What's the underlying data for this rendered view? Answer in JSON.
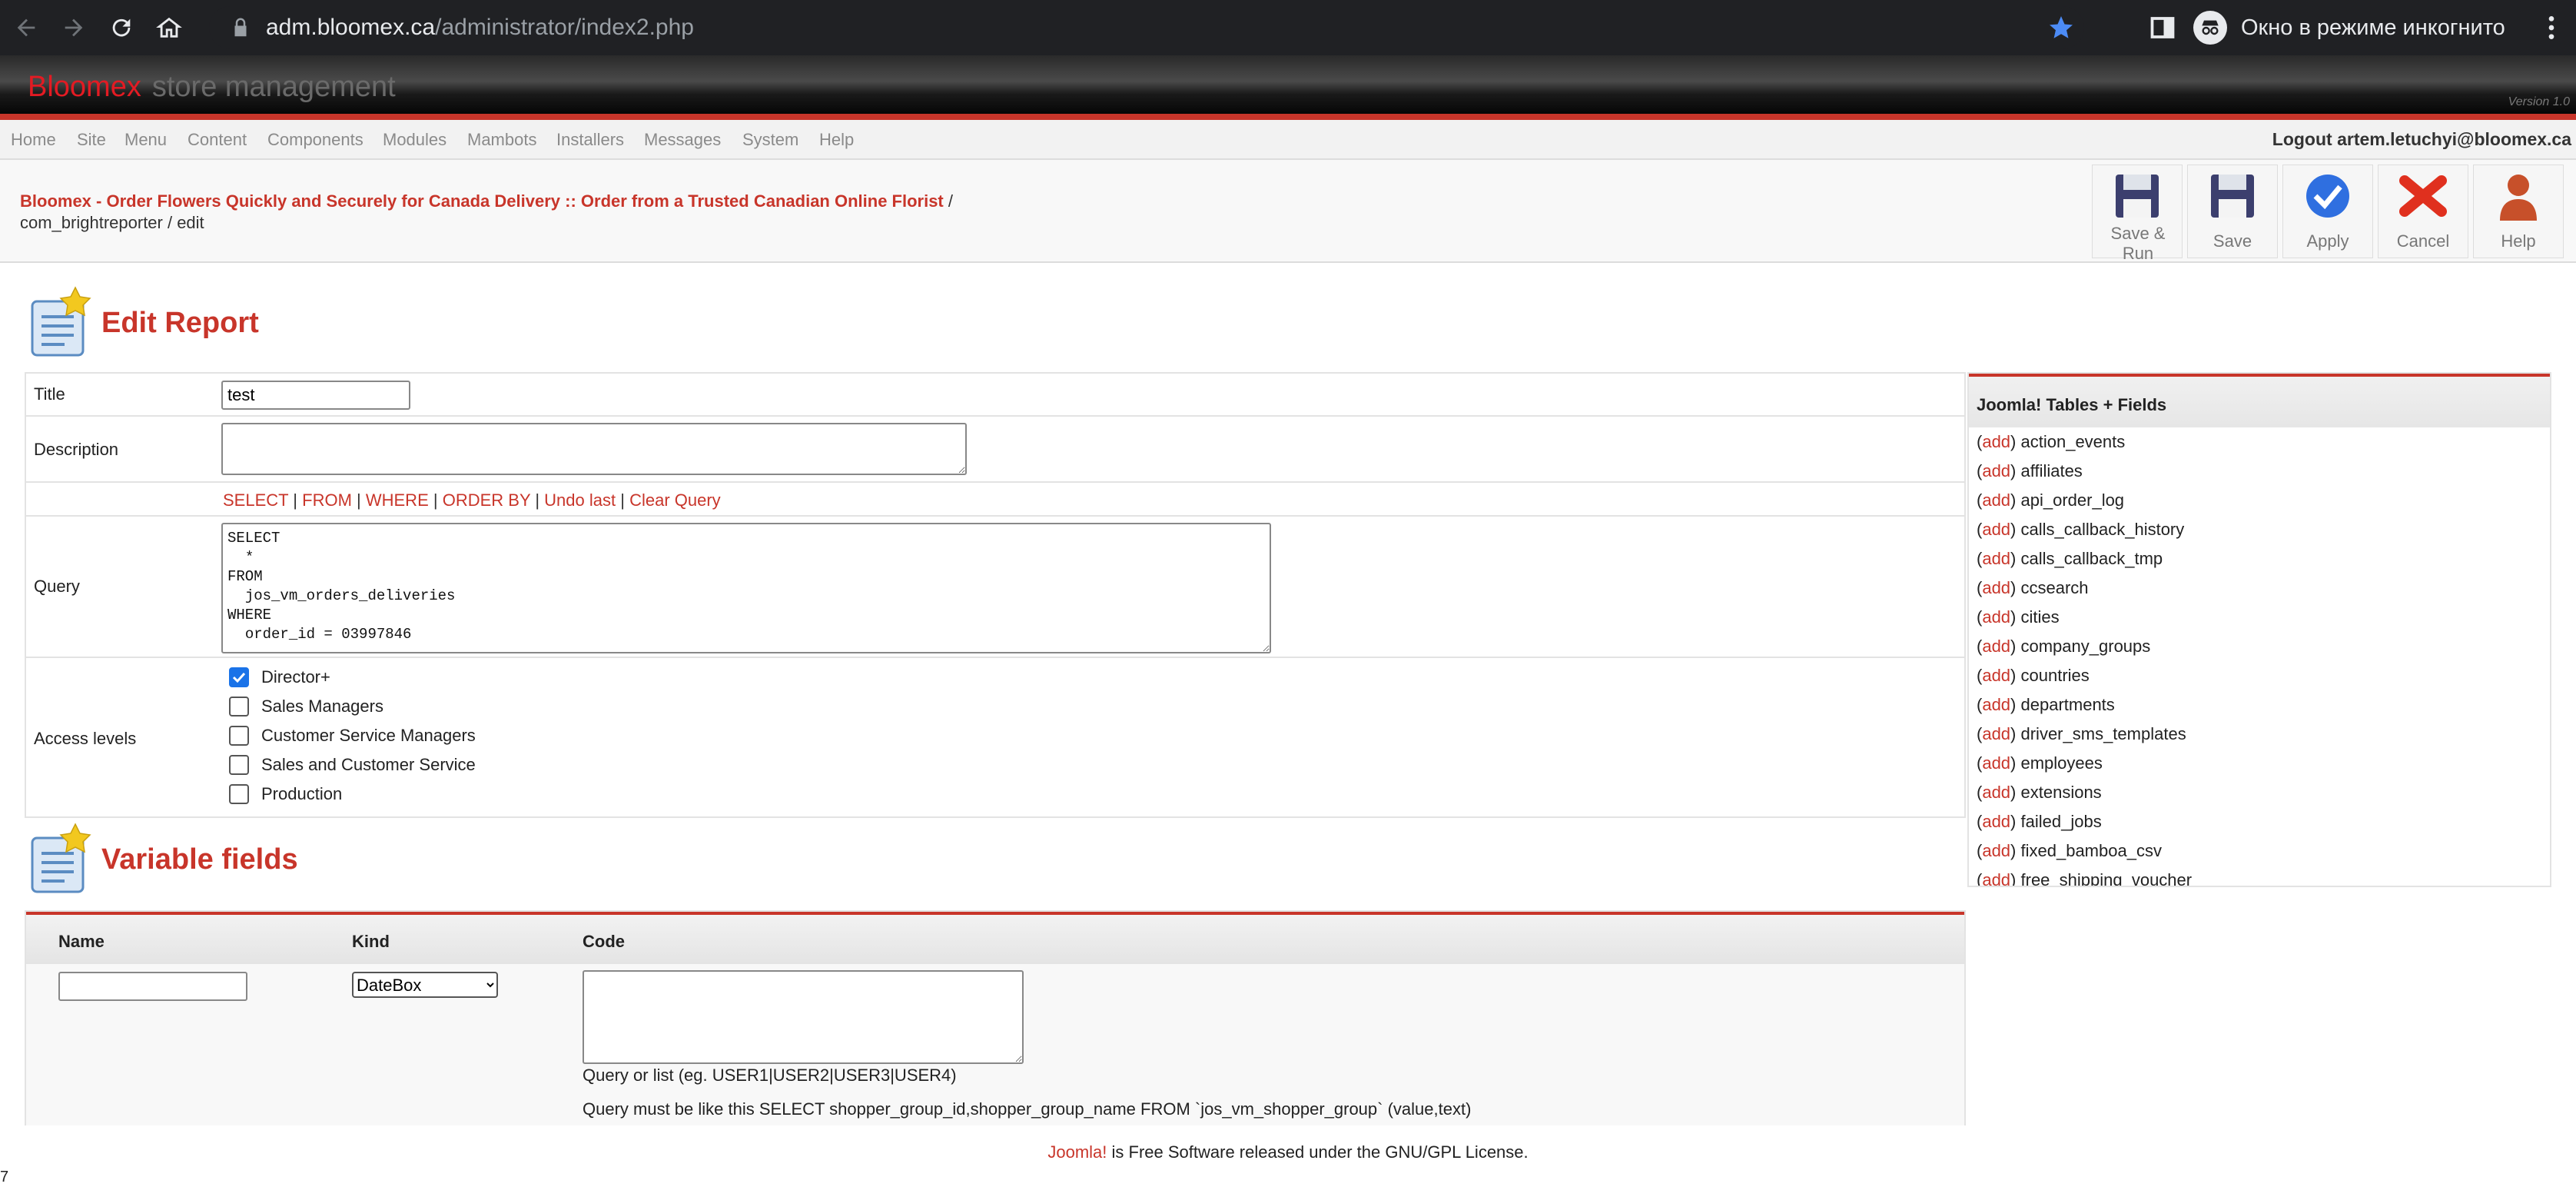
{
  "browser": {
    "url_host": "adm.bloomex.ca",
    "url_path": "/administrator/index2.php",
    "incognito_label": "Окно в режиме инкогнито"
  },
  "header": {
    "brand": "Bloomex",
    "subtitle": "store management",
    "version": "Version 1.0"
  },
  "menu": {
    "items": [
      "Home",
      "Site",
      "Menu",
      "Content",
      "Components",
      "Modules",
      "Mambots",
      "Installers",
      "Messages",
      "System",
      "Help"
    ],
    "logout": "Logout artem.letuchyi@bloomex.ca"
  },
  "pathway": {
    "site": "Bloomex - Order Flowers Quickly and Securely for Canada Delivery :: Order from a Trusted Canadian Online Florist",
    "sep": " /",
    "rest": "com_brightreporter / edit"
  },
  "toolbar": {
    "save_run": "Save & Run",
    "save": "Save",
    "apply": "Apply",
    "cancel": "Cancel",
    "help": "Help"
  },
  "edit_report": {
    "heading": "Edit Report",
    "title_label": "Title",
    "title_value": "test",
    "description_label": "Description",
    "description_value": "",
    "query_links": [
      "SELECT",
      "FROM",
      "WHERE",
      "ORDER BY",
      "Undo last",
      "Clear Query"
    ],
    "query_label": "Query",
    "query_value": "SELECT\n  *\nFROM\n  jos_vm_orders_deliveries\nWHERE\n  order_id = 03997846",
    "access_label": "Access levels",
    "access_levels": [
      {
        "label": "Director+",
        "checked": true
      },
      {
        "label": "Sales Managers",
        "checked": false
      },
      {
        "label": "Customer Service Managers",
        "checked": false
      },
      {
        "label": "Sales and Customer Service",
        "checked": false
      },
      {
        "label": "Production",
        "checked": false
      }
    ]
  },
  "tables_panel": {
    "title": "Joomla! Tables + Fields",
    "add_label": "add",
    "tables": [
      "action_events",
      "affiliates",
      "api_order_log",
      "calls_callback_history",
      "calls_callback_tmp",
      "ccsearch",
      "cities",
      "company_groups",
      "countries",
      "departments",
      "driver_sms_templates",
      "employees",
      "extensions",
      "failed_jobs",
      "fixed_bamboa_csv",
      "free_shipping_voucher"
    ]
  },
  "variable_fields": {
    "heading": "Variable fields",
    "col_name": "Name",
    "col_kind": "Kind",
    "col_code": "Code",
    "name_value": "",
    "kind_value": "DateBox",
    "code_value": "",
    "hint_list": "Query or list (eg. USER1|USER2|USER3|USER4)",
    "hint_query": "Query must be like this SELECT shopper_group_id,shopper_group_name FROM `jos_vm_shopper_group` (value,text)"
  },
  "footer": {
    "link": "Joomla!",
    "text": " is Free Software released under the GNU/GPL License."
  },
  "stray_char": "7"
}
